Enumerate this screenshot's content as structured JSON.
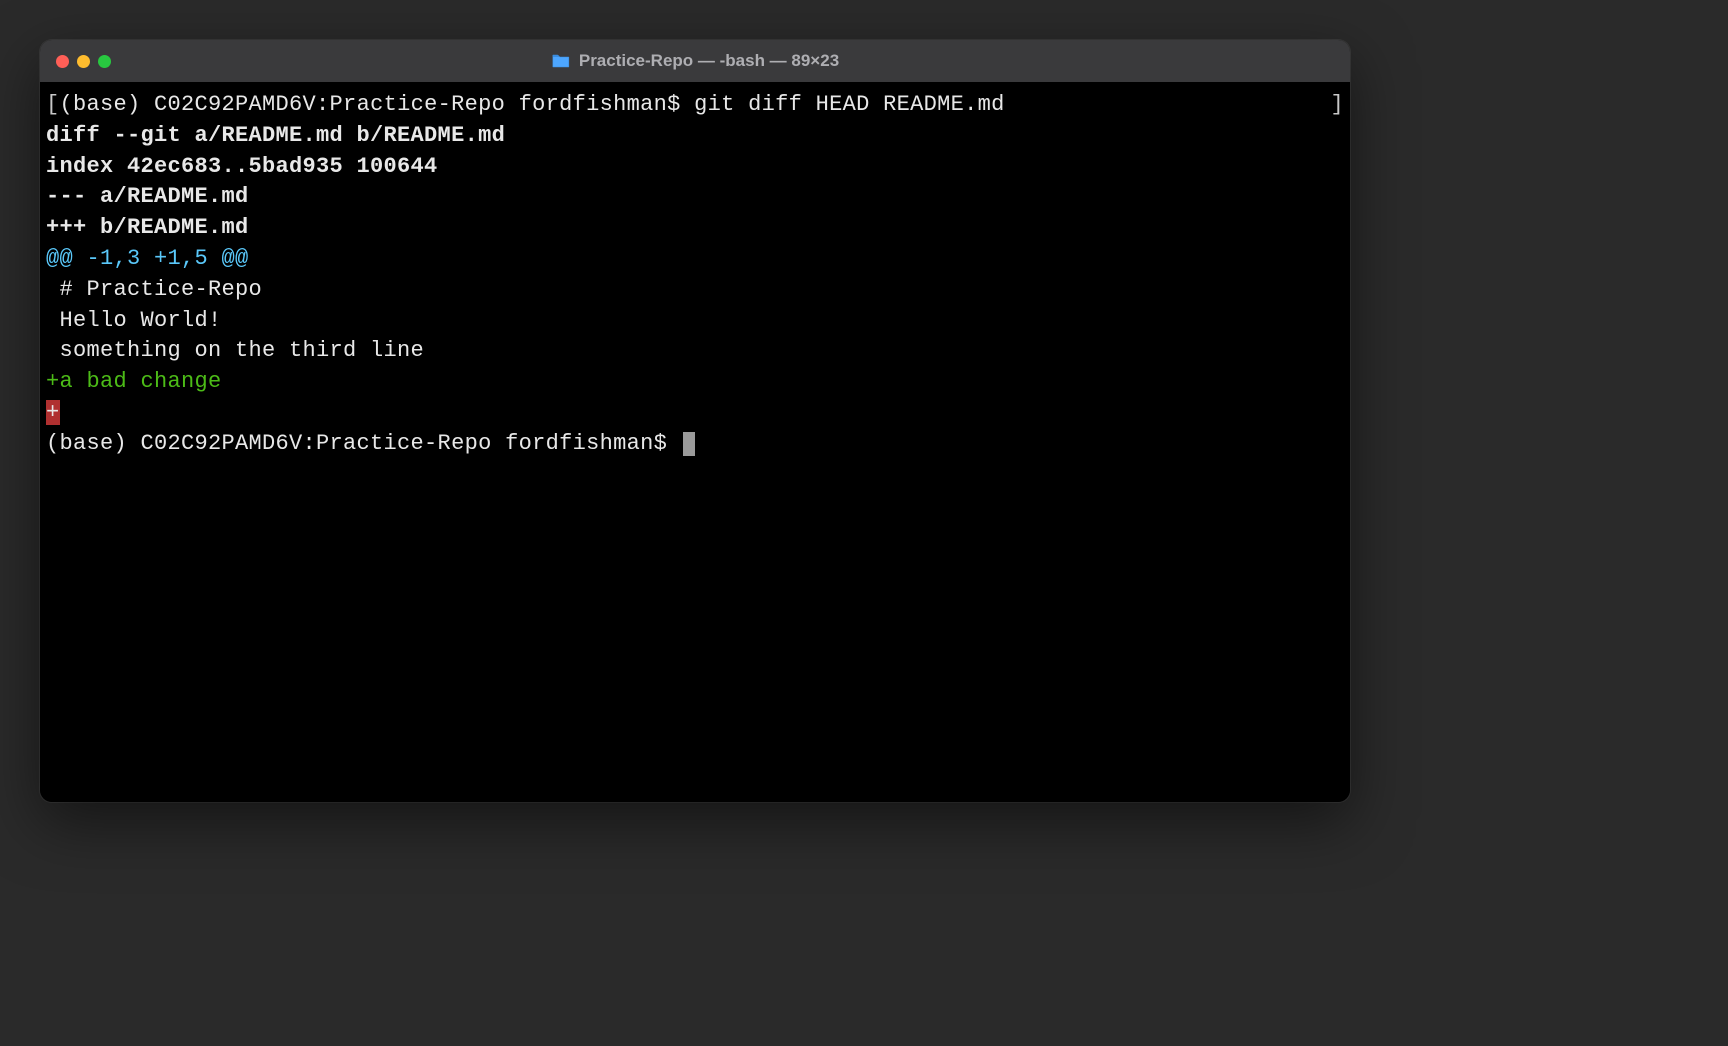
{
  "window": {
    "title": "Practice-Repo — -bash — 89×23",
    "folder_icon": "folder-icon"
  },
  "terminal": {
    "prompt1_open_bracket": "[",
    "prompt1": "(base) C02C92PAMD6V:Practice-Repo fordfishman$ git diff HEAD README.md",
    "prompt1_close_bracket": "]",
    "diff_header": "diff --git a/README.md b/README.md",
    "index_line": "index 42ec683..5bad935 100644",
    "minus_file": "--- a/README.md",
    "plus_file": "+++ b/README.md",
    "hunk": "@@ -1,3 +1,5 @@",
    "context1": " # Practice-Repo",
    "context2": " Hello World!",
    "context3": " something on the third line",
    "added1": "+a bad change",
    "added2": "+",
    "prompt2": "(base) C02C92PAMD6V:Practice-Repo fordfishman$ "
  }
}
